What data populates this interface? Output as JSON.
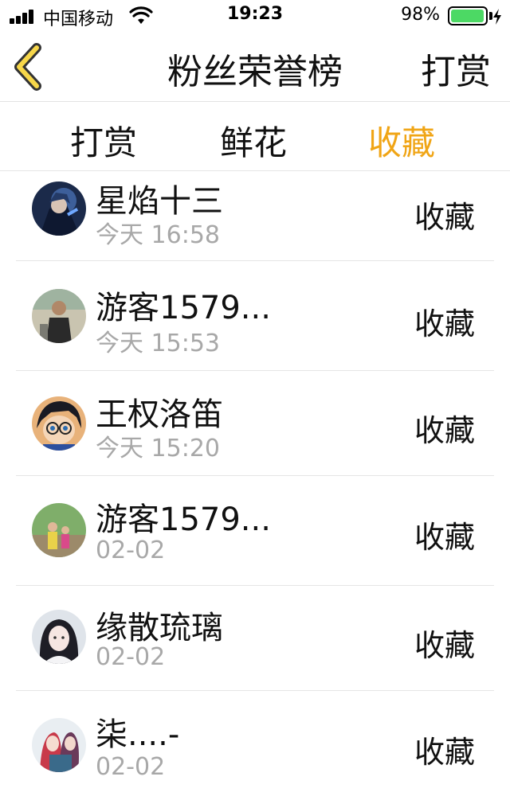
{
  "status_bar": {
    "carrier": "中国移动",
    "time": "19:23",
    "battery_percent": "98%",
    "battery_level": 0.98,
    "signal_icon": "signal-bars-icon",
    "wifi_icon": "wifi-icon",
    "battery_icon": "battery-icon",
    "charging_icon": "bolt-icon"
  },
  "nav": {
    "back_icon": "chevron-left-icon",
    "title": "粉丝荣誉榜",
    "action_label": "打赏"
  },
  "tabs": [
    {
      "label": "打赏",
      "active": false
    },
    {
      "label": "鲜花",
      "active": false
    },
    {
      "label": "收藏",
      "active": true
    }
  ],
  "colors": {
    "accent": "#f0a516",
    "back_chevron": "#f7d74a",
    "subtext": "#a8a8a8",
    "divider": "#e5e5e5",
    "battery_green": "#4cd964"
  },
  "fans": [
    {
      "name": "星焰十三",
      "time": "今天 16:58",
      "badge": "收藏",
      "avatar_icon": "avatar-anime-warrior"
    },
    {
      "name": "游客1579...",
      "time": "今天 15:53",
      "badge": "收藏",
      "avatar_icon": "avatar-man-photo"
    },
    {
      "name": "王权洛笛",
      "time": "今天 15:20",
      "badge": "收藏",
      "avatar_icon": "avatar-anime-detective"
    },
    {
      "name": "游客1579...",
      "time": "02-02",
      "badge": "收藏",
      "avatar_icon": "avatar-kids-photo"
    },
    {
      "name": "缘散琉璃",
      "time": "02-02",
      "badge": "收藏",
      "avatar_icon": "avatar-girl-white"
    },
    {
      "name": "柒....-",
      "time": "02-02",
      "badge": "收藏",
      "avatar_icon": "avatar-anime-couple"
    }
  ]
}
